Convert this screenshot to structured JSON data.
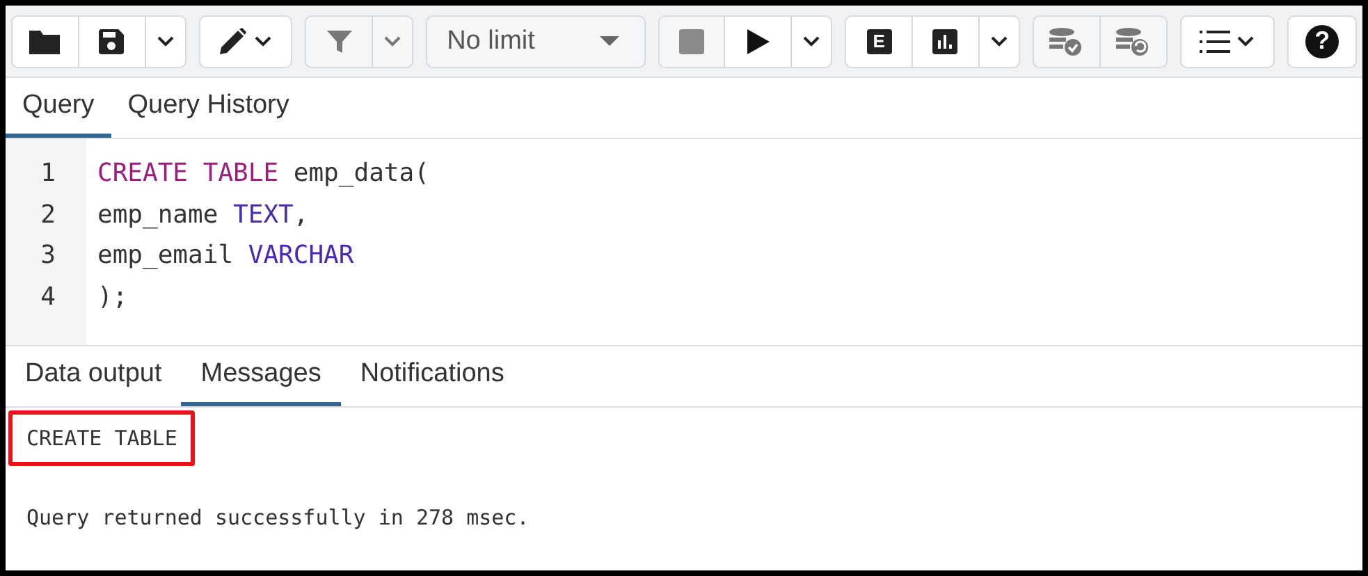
{
  "toolbar": {
    "limit_select": {
      "value": "No limit"
    },
    "stop_button": {
      "disabled": true
    },
    "explain_label": "E",
    "help_label": "?"
  },
  "query_tabs": [
    {
      "label": "Query",
      "selected": true
    },
    {
      "label": "Query History",
      "selected": false
    }
  ],
  "editor": {
    "lines": [
      {
        "number": "1",
        "tokens": [
          {
            "kind": "keyword",
            "text": "CREATE TABLE"
          },
          {
            "kind": "plain",
            "text": " emp_data("
          }
        ]
      },
      {
        "number": "2",
        "tokens": [
          {
            "kind": "plain",
            "text": "emp_name "
          },
          {
            "kind": "type",
            "text": "TEXT"
          },
          {
            "kind": "plain",
            "text": ","
          }
        ]
      },
      {
        "number": "3",
        "tokens": [
          {
            "kind": "plain",
            "text": "emp_email "
          },
          {
            "kind": "type",
            "text": "VARCHAR"
          }
        ]
      },
      {
        "number": "4",
        "tokens": [
          {
            "kind": "plain",
            "text": ");"
          }
        ]
      }
    ]
  },
  "output_tabs": [
    {
      "label": "Data output",
      "selected": false
    },
    {
      "label": "Messages",
      "selected": true
    },
    {
      "label": "Notifications",
      "selected": false
    }
  ],
  "messages": [
    {
      "text": "CREATE TABLE",
      "highlighted": true
    },
    {
      "text": "Query returned successfully in 278 msec.",
      "highlighted": false
    }
  ]
}
